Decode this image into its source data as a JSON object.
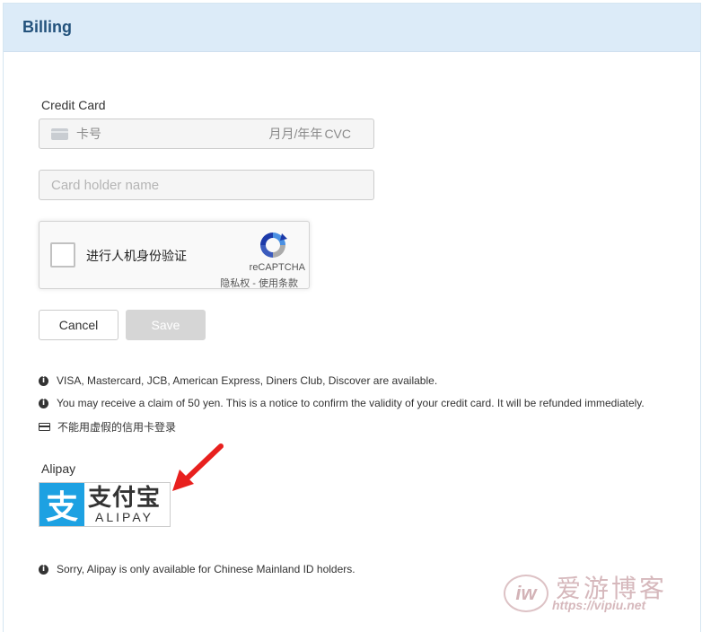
{
  "header": {
    "title": "Billing"
  },
  "credit_card": {
    "label": "Credit Card",
    "number_placeholder": "卡号",
    "expiry_placeholder": "月月/年年",
    "cvc_placeholder": "CVC",
    "holder_placeholder": "Card holder name"
  },
  "recaptcha": {
    "label": "进行人机身份验证",
    "brand": "reCAPTCHA",
    "links": "隐私权 - 使用条款"
  },
  "buttons": {
    "cancel": "Cancel",
    "save": "Save"
  },
  "notes": [
    "VISA, Mastercard, JCB, American Express, Diners Club, Discover are available.",
    "You may receive a claim of 50 yen. This is a notice to confirm the validity of your credit card. It will be refunded immediately.",
    "不能用虚假的信用卡登录"
  ],
  "alipay": {
    "label": "Alipay",
    "logo_cn": "支付宝",
    "logo_en": "ALIPAY",
    "logo_mark": "支",
    "note": "Sorry, Alipay is only available for Chinese Mainland ID holders."
  },
  "watermark": {
    "badge": "iw",
    "title": "爱游博客",
    "url": "https://vipiu.net"
  },
  "icons": {
    "card": "credit-card-icon",
    "info": "info-circle-icon",
    "recaptcha": "recaptcha-logo-icon",
    "arrow": "red-arrow-icon"
  },
  "colors": {
    "header_bg": "#dcebf8",
    "title": "#23527c",
    "alipay_blue": "#1da1e2",
    "arrow_red": "#e8201e"
  }
}
